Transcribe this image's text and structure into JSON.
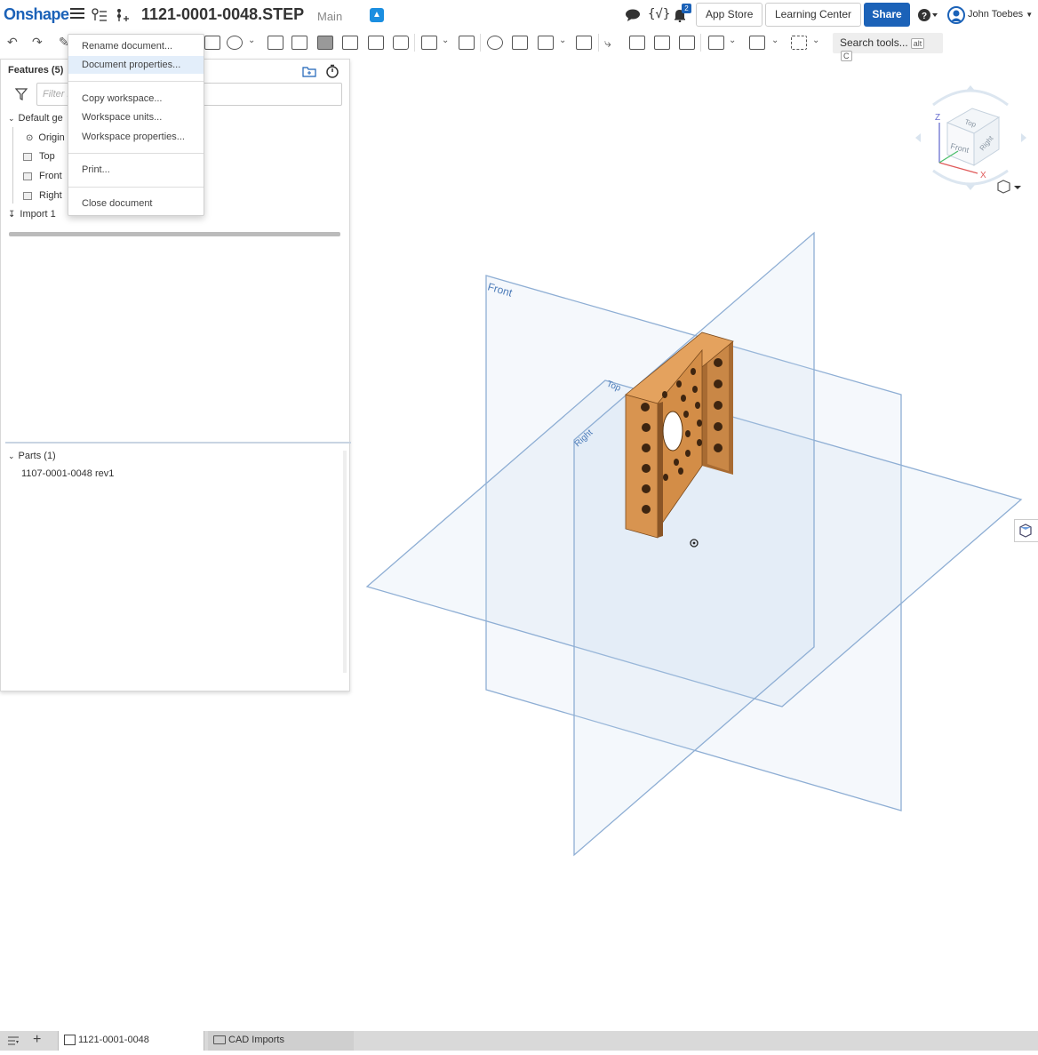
{
  "app": {
    "logo": "Onshape",
    "document_title": "1121-0001-0048.STEP",
    "branch": "Main",
    "notification_count": "2",
    "app_store_label": "App Store",
    "learning_center_label": "Learning Center",
    "share_label": "Share",
    "user_name": "John Toebes"
  },
  "toolbar": {
    "search_label": "Search tools...",
    "search_shortcut_1": "alt",
    "search_shortcut_2": "C"
  },
  "menu": {
    "items": [
      "Rename document...",
      "Document properties...",
      "Copy workspace...",
      "Workspace units...",
      "Workspace properties...",
      "Print...",
      "Close document"
    ],
    "highlighted": "Document properties..."
  },
  "features": {
    "title": "Features (5)",
    "filter_placeholder": "Filter b",
    "group_label": "Default ge",
    "origin": "Origin",
    "planes": [
      "Top",
      "Front",
      "Right"
    ],
    "import": "Import 1"
  },
  "parts": {
    "title": "Parts (1)",
    "items": [
      "1107-0001-0048 rev1"
    ]
  },
  "viewport": {
    "plane_labels": [
      "Front",
      "Top",
      "Right"
    ],
    "view_cube_faces": [
      "Top",
      "Front",
      "Right"
    ],
    "axis_labels": [
      "Z",
      "X"
    ],
    "part_color": "#d38d47",
    "plane_stroke": "#8eaed4"
  },
  "bottom_tabs": {
    "part_studio": "1121-0001-0048",
    "folder": "CAD Imports"
  }
}
